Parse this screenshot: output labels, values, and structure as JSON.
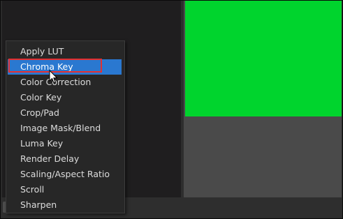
{
  "filter_menu": {
    "items": [
      {
        "label": "Apply LUT"
      },
      {
        "label": "Chroma Key",
        "selected": true
      },
      {
        "label": "Color Correction"
      },
      {
        "label": "Color Key"
      },
      {
        "label": "Crop/Pad"
      },
      {
        "label": "Image Mask/Blend"
      },
      {
        "label": "Luma Key"
      },
      {
        "label": "Render Delay"
      },
      {
        "label": "Scaling/Aspect Ratio"
      },
      {
        "label": "Scroll"
      },
      {
        "label": "Sharpen"
      }
    ]
  },
  "preview": {
    "fill_color": "#00d42d",
    "background_color": "#4a4a4a"
  },
  "colors": {
    "selection": "#2a78d0",
    "annotation_outline": "#e43030"
  },
  "icons": {
    "cursor": "arrow-cursor-icon",
    "bottom_left": "add-filter-icon"
  }
}
